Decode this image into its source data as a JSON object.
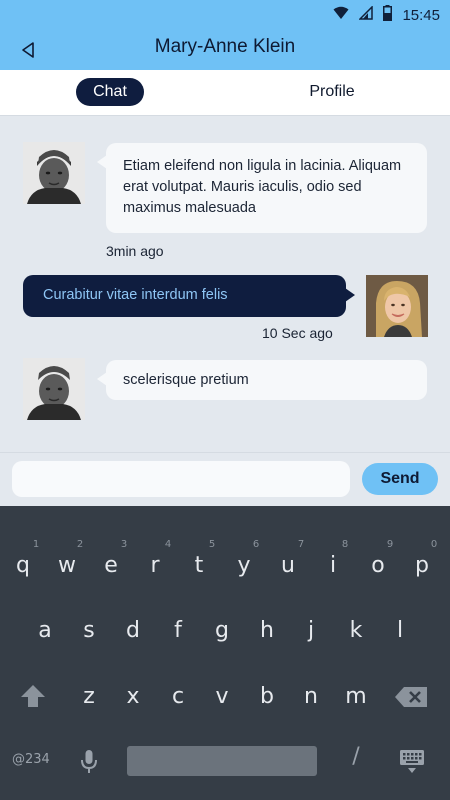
{
  "status_bar": {
    "time": "15:45"
  },
  "header": {
    "title": "Mary-Anne Klein"
  },
  "tabs": [
    {
      "label": "Chat"
    },
    {
      "label": "Profile"
    }
  ],
  "messages": [
    {
      "direction": "incoming",
      "text": "Etiam eleifend non ligula in lacinia. Aliquam erat volutpat. Mauris iaculis, odio sed maximus malesuada",
      "time": "3min ago"
    },
    {
      "direction": "outgoing",
      "text": "Curabitur vitae interdum felis",
      "time": "10 Sec ago"
    },
    {
      "direction": "incoming",
      "text": "scelerisque pretium"
    }
  ],
  "composer": {
    "value": "",
    "send_label": "Send"
  },
  "keyboard": {
    "row1": [
      {
        "key": "q",
        "hint": "1"
      },
      {
        "key": "w",
        "hint": "2"
      },
      {
        "key": "e",
        "hint": "3"
      },
      {
        "key": "r",
        "hint": "4"
      },
      {
        "key": "t",
        "hint": "5"
      },
      {
        "key": "y",
        "hint": "6"
      },
      {
        "key": "u",
        "hint": "7"
      },
      {
        "key": "i",
        "hint": "8"
      },
      {
        "key": "o",
        "hint": "9"
      },
      {
        "key": "p",
        "hint": "0"
      }
    ],
    "row2": [
      "a",
      "s",
      "d",
      "f",
      "g",
      "h",
      "j",
      "k",
      "l"
    ],
    "row3": [
      "z",
      "x",
      "c",
      "v",
      "b",
      "n",
      "m"
    ],
    "symbols_label": "@234",
    "slash": "/",
    "colors": {
      "background": "#353d46",
      "key_text": "#e7eaee"
    }
  },
  "colors": {
    "accent": "#6fc1f5",
    "navy": "#0f1d3f",
    "chat_bg": "#e3e8ee"
  }
}
